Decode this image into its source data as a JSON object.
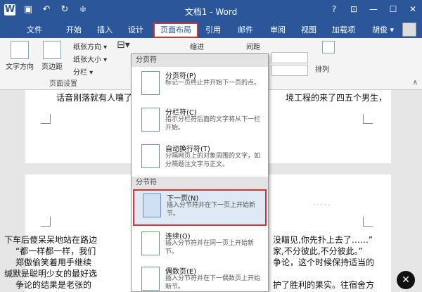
{
  "app": {
    "title": "文档1 - Word",
    "window_buttons": [
      "?",
      "⊡",
      "—",
      "☐",
      "✕"
    ],
    "user": "胡俊 ▾"
  },
  "tabs": [
    {
      "label": "文件"
    },
    {
      "label": "开始"
    },
    {
      "label": "插入"
    },
    {
      "label": "设计"
    },
    {
      "label": "页面布局"
    },
    {
      "label": "引用"
    },
    {
      "label": "邮件"
    },
    {
      "label": "审阅"
    },
    {
      "label": "视图"
    },
    {
      "label": "加载项"
    }
  ],
  "ribbon": {
    "text_direction": "文字方向",
    "margins": "页边距",
    "orientation": "纸张方向 ▾",
    "size": "纸张大小 ▾",
    "columns": "分栏 ▾",
    "group_page_setup": "页面设置",
    "indent": "缩进",
    "spacing": "间距",
    "arrange": "排列"
  },
  "menu": {
    "page_breaks_header": "分页符",
    "section_breaks_header": "分节符",
    "items": [
      {
        "title": "分页符(P)",
        "desc": "标记一页终止并开始下一页的点。"
      },
      {
        "title": "分栏符(C)",
        "desc": "指示分栏符后面的文字将从下一栏开始。"
      },
      {
        "title": "自动换行符(T)",
        "desc": "分隔网页上的对象周围的文字，如分隔题注文字与正文。"
      },
      {
        "title": "下一页(N)",
        "desc": "插入分节符并在下一页上开始新节。"
      },
      {
        "title": "连续(O)",
        "desc": "插入分节符并在同一页上开始新节。"
      },
      {
        "title": "偶数页(E)",
        "desc": "插入分节符并在下一偶数页上开始新节。"
      }
    ]
  },
  "document": {
    "page1_line": "话音刚落就有人嚷了",
    "page1_line_right": "境工程的来了四五个男生，",
    "page2_lines": [
      "下车后傻呆呆地站在路边",
      "“都一样都一样，我们",
      "郑傲偷笑着用手继续",
      "缄默是聪明少女的最好选",
      "争论的结果是老张的"
    ],
    "page2_lines_right": [
      "没瞄见,你先扑上去了……”",
      "家,不分彼此,不分彼此。”",
      "争论，这个时候保持适当的",
      "",
      "护了胜利的果实。往宿舍方"
    ],
    "blurred_text": "·····"
  }
}
